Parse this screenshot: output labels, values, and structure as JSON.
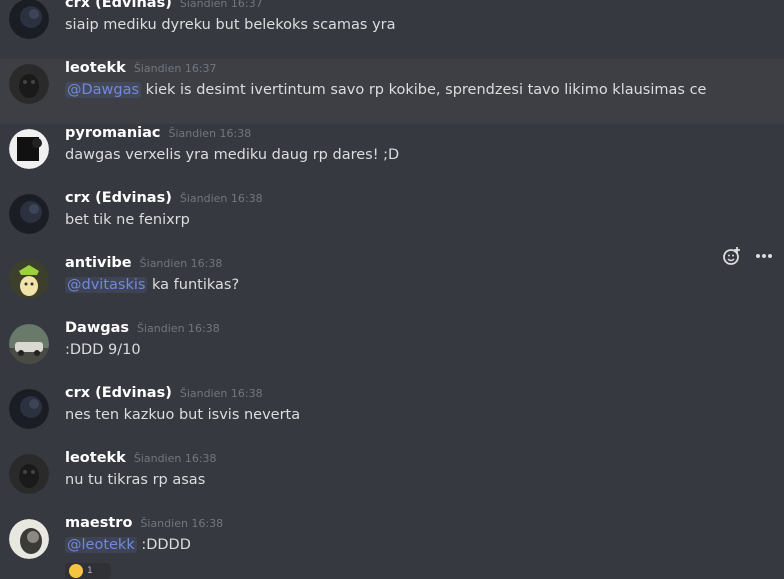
{
  "colors": {
    "background": "#36393f",
    "highlight": "#3d3f45",
    "mention": "#7289da",
    "timestamp": "#72767d"
  },
  "messages": [
    {
      "username": "crx (Edvinas)",
      "timestamp": "Šiandien 16:37",
      "text": "siaip mediku dyreku but belekoks scamas yra"
    },
    {
      "username": "leotekk",
      "timestamp": "Šiandien 16:37",
      "mention": "@Dawgas",
      "text": " kiek is desimt ivertintum savo rp kokibe, sprendzesi tavo likimo klausimas ce"
    },
    {
      "username": "pyromaniac",
      "timestamp": "Šiandien 16:38",
      "text": "dawgas verxelis yra mediku daug rp dares! ;D"
    },
    {
      "username": "crx (Edvinas)",
      "timestamp": "Šiandien 16:38",
      "text": "bet tik ne fenixrp"
    },
    {
      "username": "antivibe",
      "timestamp": "Šiandien 16:38",
      "mention": "@dvitaskis",
      "text": " ka funtikas?"
    },
    {
      "username": "Dawgas",
      "timestamp": "Šiandien 16:38",
      "text": ":DDD 9/10"
    },
    {
      "username": "crx (Edvinas)",
      "timestamp": "Šiandien 16:38",
      "text": "nes ten kazkuo but isvis neverta"
    },
    {
      "username": "leotekk",
      "timestamp": "Šiandien 16:38",
      "text": "nu tu tikras rp asas"
    },
    {
      "username": "maestro",
      "timestamp": "Šiandien 16:38",
      "mention": "@leotekk",
      "text": " :DDDD",
      "reaction": {
        "emoji": "laughing-emoji",
        "count": "1"
      }
    }
  ],
  "toolbar": {
    "icons": [
      "add-reaction-icon",
      "more-options-icon"
    ]
  }
}
